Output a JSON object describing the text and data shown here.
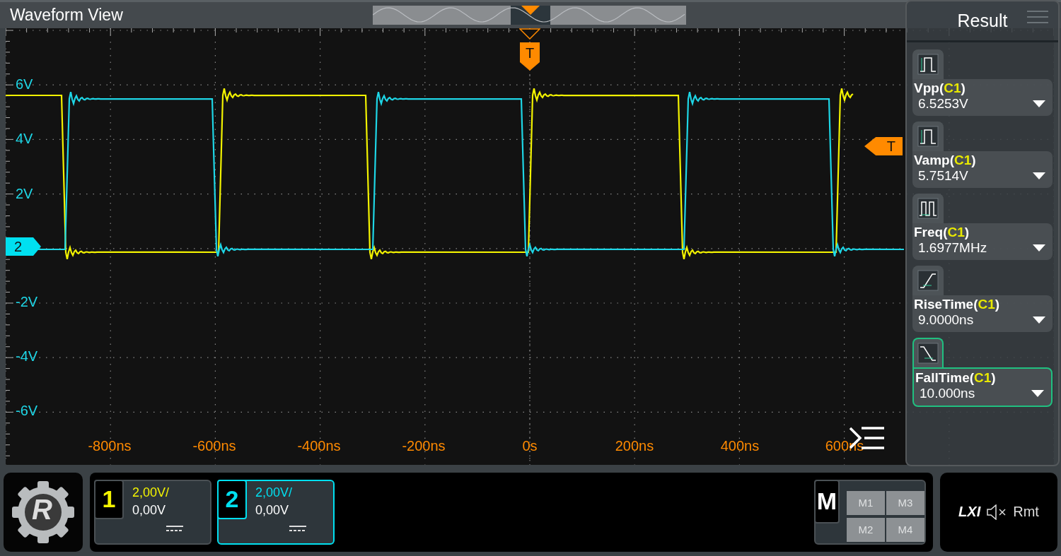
{
  "header": {
    "title": "Waveform View"
  },
  "trigger": {
    "time_marker": "T",
    "level_marker": "T"
  },
  "waveform_view": {
    "y_labels": [
      "6V",
      "4V",
      "2V",
      "-2V",
      "-4V",
      "-6V"
    ],
    "x_labels": [
      "-800ns",
      "-600ns",
      "-400ns",
      "-200ns",
      "0s",
      "200ns",
      "400ns",
      "600ns"
    ],
    "channel_marker": {
      "label": "2",
      "color": "#00e0f0"
    }
  },
  "result_panel": {
    "title": "Result",
    "measurements": [
      {
        "kind": "pulse",
        "label": "Vpp(**C1**)",
        "value": "6.5253V",
        "selected": false
      },
      {
        "kind": "pulse",
        "label": "Vamp(**C1**)",
        "value": "5.7514V",
        "selected": false
      },
      {
        "kind": "pulses",
        "label": "Freq(**C1**)",
        "value": "1.6977MHz",
        "selected": false
      },
      {
        "kind": "rise",
        "label": "RiseTime(**C1**)",
        "value": "9.0000ns",
        "selected": false
      },
      {
        "kind": "fall",
        "label": "FallTime(**C1**)",
        "value": "10.000ns",
        "selected": true
      }
    ]
  },
  "logo": {
    "text": "R"
  },
  "channels": [
    {
      "number": "1",
      "scale": "2,00V/",
      "offset": "0,00V",
      "color": "#f5f500",
      "selected": false
    },
    {
      "number": "2",
      "scale": "2,00V/",
      "offset": "0,00V",
      "color": "#00e0f0",
      "selected": true
    }
  ],
  "math": {
    "label": "M",
    "buttons": [
      "M1",
      "M3",
      "M2",
      "M4"
    ]
  },
  "status": {
    "lxi": "LXI",
    "remote": "Rmt"
  }
}
